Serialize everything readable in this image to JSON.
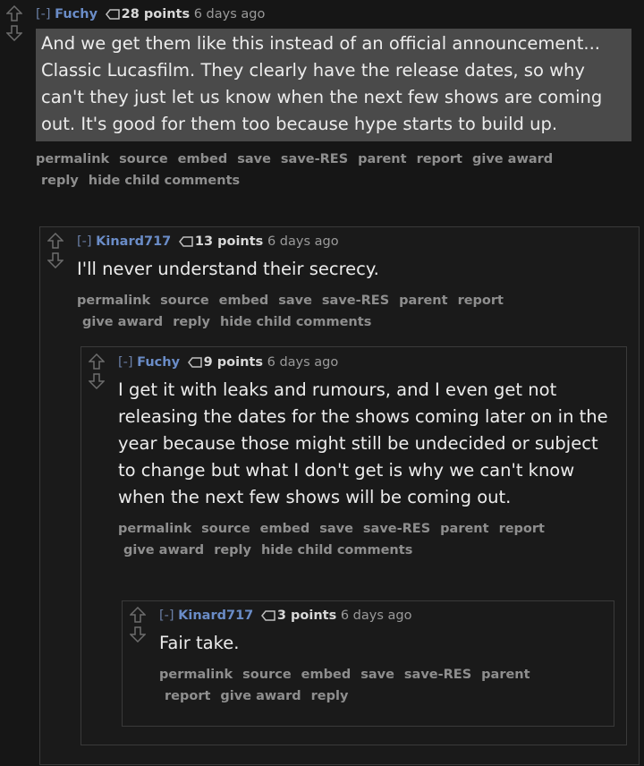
{
  "comments": [
    {
      "collapse": "[-]",
      "author": "Fuchy",
      "score": "28 points",
      "time": "6 days ago",
      "body": "And we get them like this instead of an official announcement... Classic Lucasfilm. They clearly have the release dates, so why can't they just let us know when the next few shows are coming out. It's good for them too because hype starts to build up.",
      "buttons": [
        "permalink",
        "source",
        "embed",
        "save",
        "save-RES",
        "parent",
        "report",
        "give award",
        "reply",
        "hide child comments"
      ]
    },
    {
      "collapse": "[-]",
      "author": "Kinard717",
      "score": "13 points",
      "time": "6 days ago",
      "body": "I'll never understand their secrecy.",
      "buttons": [
        "permalink",
        "source",
        "embed",
        "save",
        "save-RES",
        "parent",
        "report",
        "give award",
        "reply",
        "hide child comments"
      ]
    },
    {
      "collapse": "[-]",
      "author": "Fuchy",
      "score": "9 points",
      "time": "6 days ago",
      "body": "I get it with leaks and rumours, and I even get not releasing the dates for the shows coming later on in the year because those might still be undecided or subject to change but what I don't get is why we can't know when the next few shows will be coming out.",
      "buttons": [
        "permalink",
        "source",
        "embed",
        "save",
        "save-RES",
        "parent",
        "report",
        "give award",
        "reply",
        "hide child comments"
      ]
    },
    {
      "collapse": "[-]",
      "author": "Kinard717",
      "score": "3 points",
      "time": "6 days ago",
      "body": "Fair take.",
      "buttons": [
        "permalink",
        "source",
        "embed",
        "save",
        "save-RES",
        "parent",
        "report",
        "give award",
        "reply"
      ]
    }
  ]
}
